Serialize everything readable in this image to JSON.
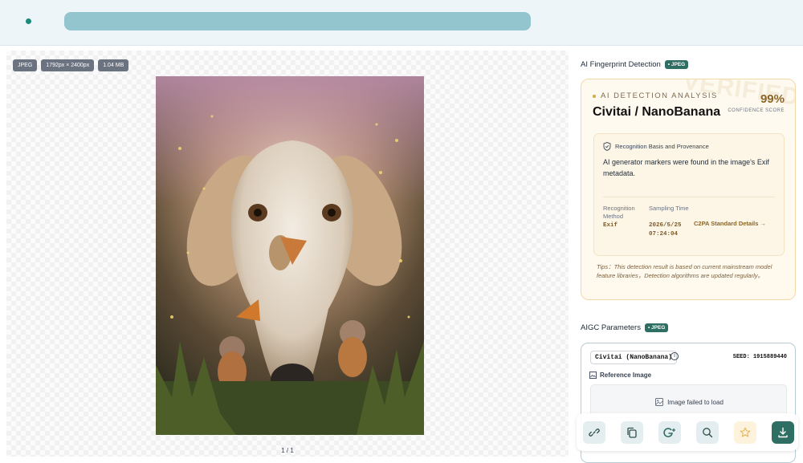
{
  "topbar": {
    "url": ""
  },
  "image": {
    "format": "JPEG",
    "dimensions": "1792px × 2400px",
    "size": "1.04 MB",
    "pager": "1 / 1"
  },
  "fingerprint": {
    "section_title": "AI Fingerprint Detection",
    "badge": "• JPEG",
    "watermark": "VERIFIED",
    "label": "AI DETECTION ANALYSIS",
    "title": "Civitai / NanoBanana",
    "score": "99%",
    "score_label": "CONFIDENCE SCORE",
    "basis_title": "Recognition Basis and Provenance",
    "basis_text": "AI generator markers were found in the image's Exif metadata.",
    "method_label": "Recognition Method",
    "method_value": "Exif",
    "time_label": "Sampling Time",
    "time_date": "2026/5/25",
    "time_clock": "07:24:04",
    "c2pa_link": "C2PA Standard Details →",
    "tips": "Tips：This detection result is based on current mainstream model feature libraries，Detection algorithms are updated regularly。"
  },
  "aigc": {
    "section_title": "AIGC Parameters",
    "badge": "• JPEG",
    "model": "Civitai (NanoBanana)",
    "seed": "SEED: 1915889440",
    "reference_label": "Reference Image",
    "reference_fail": "Image failed to load"
  },
  "toolbar": {
    "icons": [
      "link-icon",
      "copy-icon",
      "google-lens-icon",
      "search-icon",
      "star-icon",
      "download-icon"
    ],
    "accent": "#2f6e63"
  }
}
